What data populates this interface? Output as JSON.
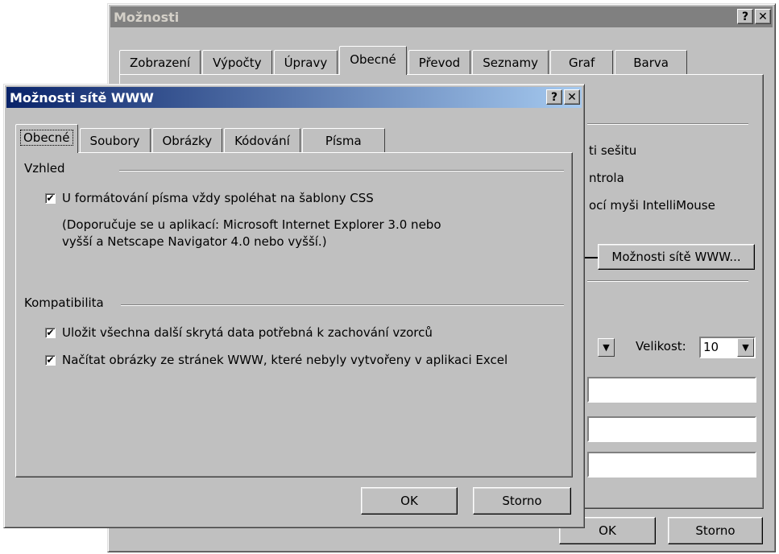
{
  "back_dialog": {
    "title": "Možnosti",
    "help_btn": "?",
    "close_btn": "✕",
    "tabs": [
      "Zobrazení",
      "Výpočty",
      "Úpravy",
      "Obecné",
      "Převod",
      "Seznamy",
      "Graf",
      "Barva"
    ],
    "selected_tab": "Obecné",
    "visible_text": {
      "sesitu": "ti sešitu",
      "kontrola": "ntrola",
      "intellimouse": "ocí myši IntelliMouse"
    },
    "web_options_button": "Možnosti sítě WWW...",
    "size_label": "Velikost:",
    "size_value": "10",
    "ok_button": "OK",
    "cancel_button": "Storno"
  },
  "front_dialog": {
    "title": "Možnosti sítě WWW",
    "help_btn": "?",
    "close_btn": "✕",
    "tabs": [
      "Obecné",
      "Soubory",
      "Obrázky",
      "Kódování",
      "Písma"
    ],
    "selected_tab": "Obecné",
    "groups": {
      "appearance_label": "Vzhled",
      "css_checkbox_label": "U formátování písma vždy spoléhat na šablony CSS",
      "css_checked": true,
      "note_line1": "(Doporučuje se u aplikací: Microsoft Internet Explorer 3.0 nebo",
      "note_line2": "vyšší a Netscape Navigator 4.0 nebo vyšší.)",
      "compat_label": "Kompatibilita",
      "save_hidden_label": "Uložit všechna další skrytá data potřebná k zachování vzorců",
      "save_hidden_checked": true,
      "load_images_label": "Načítat obrázky ze stránek WWW, které nebyly vytvořeny v aplikaci Excel",
      "load_images_checked": true
    },
    "ok_button": "OK",
    "cancel_button": "Storno"
  },
  "glyphs": {
    "checkmark": "✔",
    "dropdown": "▼"
  }
}
